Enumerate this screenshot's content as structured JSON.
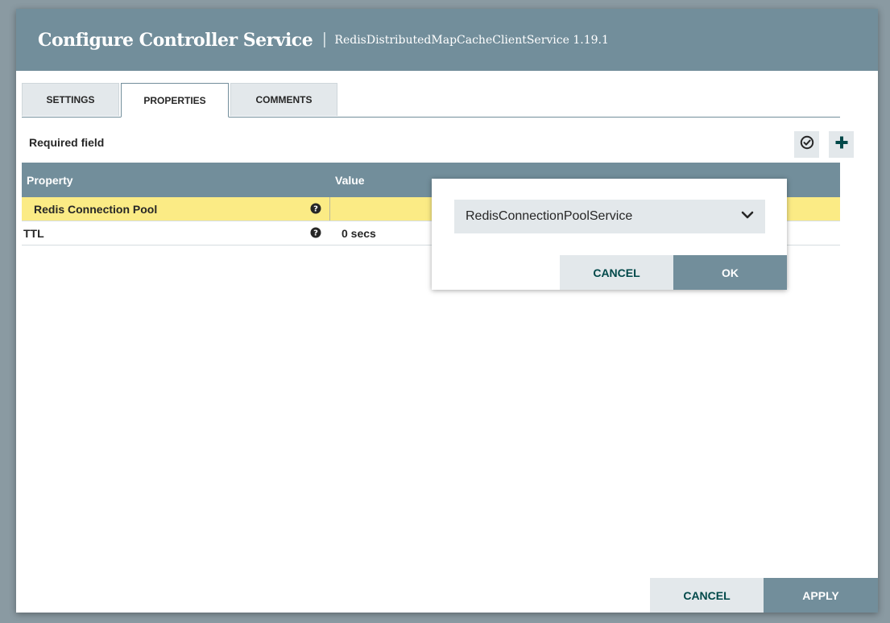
{
  "dialog": {
    "title": "Configure Controller Service",
    "separator": "|",
    "subtitle": "RedisDistributedMapCacheClientService 1.19.1"
  },
  "tabs": [
    {
      "label": "SETTINGS",
      "active": false
    },
    {
      "label": "PROPERTIES",
      "active": true
    },
    {
      "label": "COMMENTS",
      "active": false
    }
  ],
  "required_label": "Required field",
  "toolbar": {
    "verify_icon": "check-circle-icon",
    "add_icon": "plus-icon"
  },
  "table": {
    "headers": [
      "Property",
      "Value"
    ],
    "rows": [
      {
        "name": "Redis Connection Pool",
        "value": "",
        "selected": true
      },
      {
        "name": "TTL",
        "value": "0 secs",
        "selected": false
      }
    ]
  },
  "popup": {
    "selected_option": "RedisConnectionPoolService",
    "cancel_label": "CANCEL",
    "ok_label": "OK"
  },
  "footer": {
    "cancel_label": "CANCEL",
    "apply_label": "APPLY"
  },
  "colors": {
    "header": "#728e9b",
    "selected_row": "#fbeb85",
    "button_light": "#e3e8eb",
    "button_text": "#004849"
  }
}
